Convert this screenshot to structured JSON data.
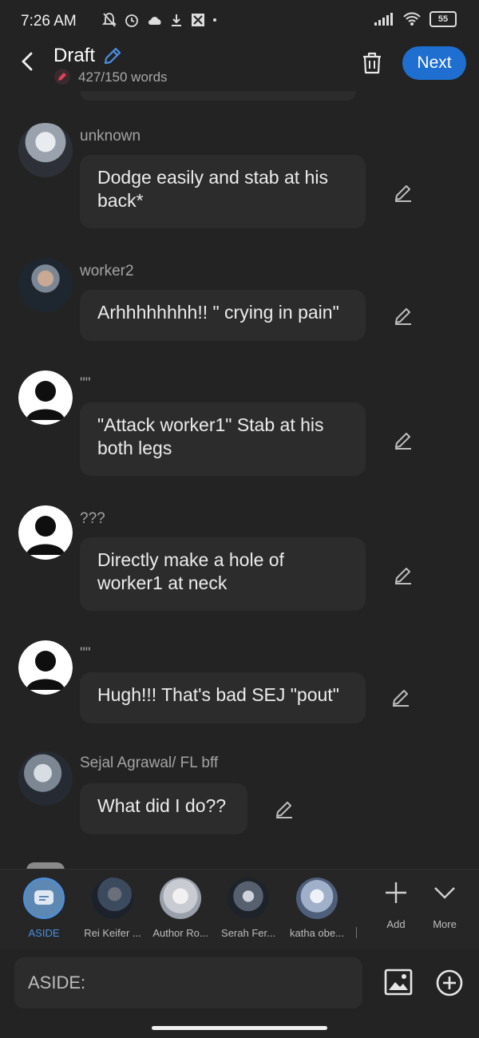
{
  "status": {
    "time": "7:26 AM",
    "battery": "55"
  },
  "header": {
    "title": "Draft",
    "word_count": "427/150 words",
    "next_label": "Next"
  },
  "messages": [
    {
      "name": "unknown",
      "text": "Dodge easily and stab at his back*"
    },
    {
      "name": "worker2",
      "text": "Arhhhhhhhh!! \" crying in pain\""
    },
    {
      "name": "\"\"",
      "text": "\"Attack worker1\" Stab at his both legs"
    },
    {
      "name": "???",
      "text": "Directly make a hole of worker1 at neck"
    },
    {
      "name": "\"\"",
      "text": "Hugh!!! That's bad SEJ \"pout\""
    },
    {
      "name": "Sejal Agrawal/ FL bff",
      "text": "What did I do??"
    }
  ],
  "characters": [
    {
      "label": "ASIDE",
      "color": "#4a90e2"
    },
    {
      "label": "Rei Keifer ..."
    },
    {
      "label": "Author Ro..."
    },
    {
      "label": "Serah Fer..."
    },
    {
      "label": "katha obe..."
    }
  ],
  "tools": {
    "add_label": "Add",
    "more_label": "More"
  },
  "composer": {
    "placeholder": "ASIDE:"
  },
  "colors": {
    "accent": "#1f6fd1",
    "bubble": "#2c2c2c",
    "background": "#232323"
  }
}
